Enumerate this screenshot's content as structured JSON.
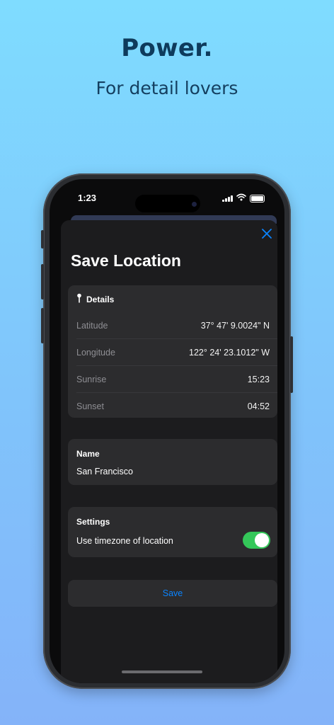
{
  "promo": {
    "headline": "Power.",
    "subheadline": "For detail lovers"
  },
  "status_bar": {
    "time": "1:23"
  },
  "sheet": {
    "title": "Save Location",
    "details": {
      "header": "Details",
      "rows": [
        {
          "label": "Latitude",
          "value": "37° 47' 9.0024\" N"
        },
        {
          "label": "Longitude",
          "value": "122° 24' 23.1012\" W"
        },
        {
          "label": "Sunrise",
          "value": "15:23"
        },
        {
          "label": "Sunset",
          "value": "04:52"
        }
      ]
    },
    "name": {
      "header": "Name",
      "value": "San Francisco"
    },
    "settings": {
      "header": "Settings",
      "toggle_label": "Use timezone of location",
      "toggle_on": true
    },
    "save_label": "Save"
  },
  "colors": {
    "accent": "#0a84ff",
    "toggle_on": "#34c759",
    "headline": "#0e3b5c"
  },
  "icons": [
    "wifi-icon",
    "battery-icon",
    "signal-icon",
    "close-icon",
    "pin-icon"
  ]
}
